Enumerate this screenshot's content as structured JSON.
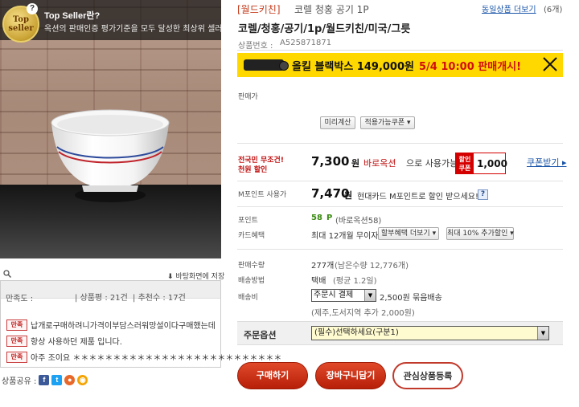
{
  "top_seller": {
    "badge_text": "Top\nseller",
    "question_mark": "?",
    "title": "Top Seller란?",
    "description": "옥션의 판매인증 평가기준을 모두 달성한 최상위 셀러"
  },
  "photo_toolbar": {
    "bg_save_label": "바탕화면에 저장"
  },
  "rating": {
    "satisfaction_label": "만족도 :",
    "score_label": "상품평 : 21건",
    "recommend_label": "추천수 : 17건",
    "badge_label": "만족",
    "reviews": [
      "납개로구매하려니가격이부담스러워망설이다구매했는데",
      "항상 사용하던 제품 입니다.",
      "아주 조이요 ＊＊＊＊＊＊＊＊＊＊＊＊＊＊＊＊＊＊＊＊＊＊＊＊＊＊"
    ]
  },
  "share": {
    "label": "상품공유 :"
  },
  "header": {
    "store_link": "[월드키친]",
    "title": "코렐 청홍 공기 1P",
    "same_products_link": "동일상품 더보기",
    "same_products_count": "(6개)",
    "subtitle": "코렐/청홍/공기/1p/월드키친/미국/그릇",
    "product_code_label": "상품번호 :",
    "product_code": "A525871871"
  },
  "banner": {
    "text": "올킬 블랙박스 149,000원",
    "date": "5/4 10:00 판매개시!"
  },
  "seller": {
    "label": "판매가",
    "calc_button": "미리계산",
    "coupon_button": "적용가능쿠폰 ▾"
  },
  "nation_price": {
    "label_line1": "전국민 무조건!",
    "label_line2": "천원 할인",
    "price": "7,300",
    "unit": "원",
    "highlight": "바로옥션",
    "suffix": "으로 사용가능",
    "badge_tag": "할인\n쿠폰",
    "badge_amount": "1,000",
    "coupon_receive": "쿠폰받기 ▸"
  },
  "mpoint": {
    "label": "M포인트 사용가",
    "price": "7,470",
    "unit": "원",
    "text": "현대카드 M포인트로 할인 받으세요!",
    "help": "?"
  },
  "points": {
    "label": "포인트",
    "value": "58",
    "unit": "P",
    "text": "(바로옥션58)"
  },
  "card": {
    "label": "카드혜택",
    "text": "최대 12개월 무이자",
    "more_button": "할부혜택 더보기 ▾",
    "extra_button": "최대 10% 추가할인 ▾"
  },
  "sales": {
    "sold_label": "판매수량",
    "sold_value": "277개",
    "remain": "(남은수량 12,776개)",
    "ship_label": "배송방법",
    "ship_value": "택배",
    "ship_avg": "(평균 1.2일)",
    "fee_label": "배송비",
    "fee_select": "주문시 결제",
    "fee_text": "2,500원 묶음배송",
    "fee_note": "(제주,도서지역 추가 2,000원)"
  },
  "option": {
    "label": "주문옵션",
    "select": "(필수)선택하세요(구분1)"
  },
  "actions": {
    "buy": "구매하기",
    "cart": "장바구니담기",
    "wish": "관심상품등록"
  }
}
